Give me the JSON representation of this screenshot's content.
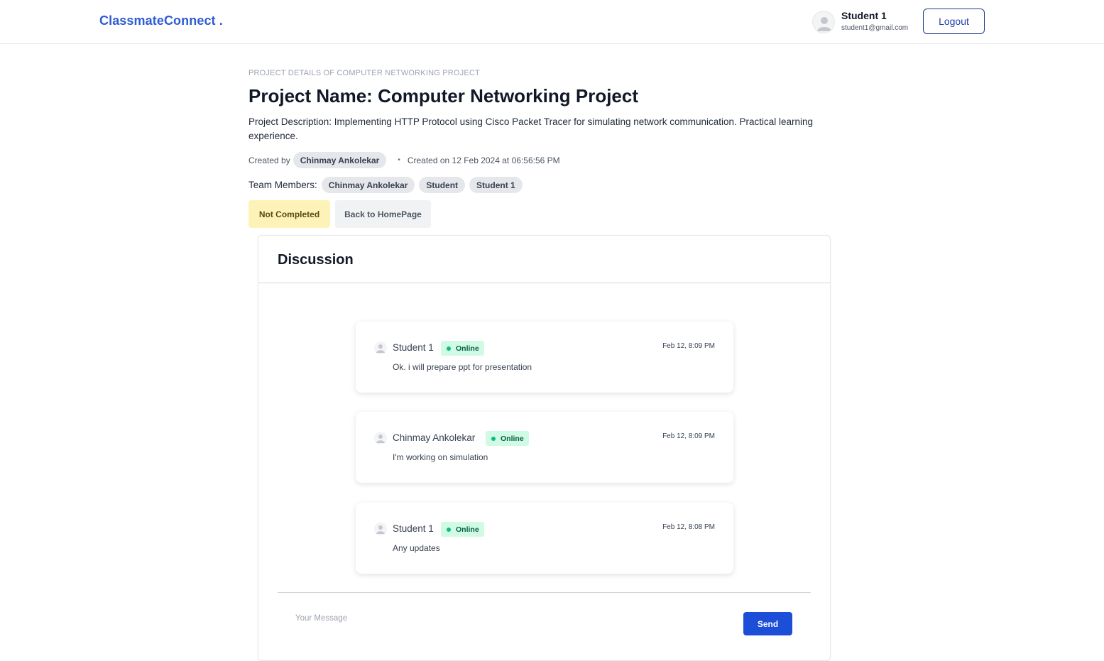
{
  "navbar": {
    "brand": "ClassmateConnect .",
    "user": {
      "name": "Student 1",
      "email": "student1@gmail.com"
    },
    "logout_label": "Logout"
  },
  "project": {
    "breadcrumb": "PROJECT DETAILS OF COMPUTER NETWORKING PROJECT",
    "title": "Project Name: Computer Networking Project",
    "description": "Project Description: Implementing HTTP Protocol using Cisco Packet Tracer for simulating network communication. Practical learning experience.",
    "created_by_label": "Created by",
    "creator": "Chinmay Ankolekar",
    "separator": "•",
    "created_on": "Created on 12 Feb 2024 at 06:56:56 PM",
    "team_label": "Team Members:",
    "team_members": [
      "Chinmay Ankolekar",
      "Student",
      "Student 1"
    ],
    "status_label": "Not Completed",
    "back_label": "Back to HomePage"
  },
  "discussion": {
    "title": "Discussion",
    "messages": [
      {
        "author": "Student 1",
        "status": "Online",
        "time": "Feb 12, 8:09 PM",
        "text": "Ok. i will prepare ppt for presentation"
      },
      {
        "author": "Chinmay Ankolekar",
        "status": "Online",
        "time": "Feb 12, 8:09 PM",
        "text": "I'm working on simulation"
      },
      {
        "author": "Student 1",
        "status": "Online",
        "time": "Feb 12, 8:08 PM",
        "text": "Any updates"
      }
    ],
    "input_placeholder": "Your Message",
    "send_label": "Send"
  },
  "colors": {
    "brand": "#2f5bd3",
    "send_button": "#1d4ed8",
    "status_not_completed_bg": "#fdf3b8",
    "online_badge_bg": "#d1fae5",
    "online_dot": "#10b981"
  },
  "icons": {
    "user_avatar": "user-avatar-icon",
    "message_avatar": "user-avatar-icon",
    "online_dot": "dot-icon"
  }
}
